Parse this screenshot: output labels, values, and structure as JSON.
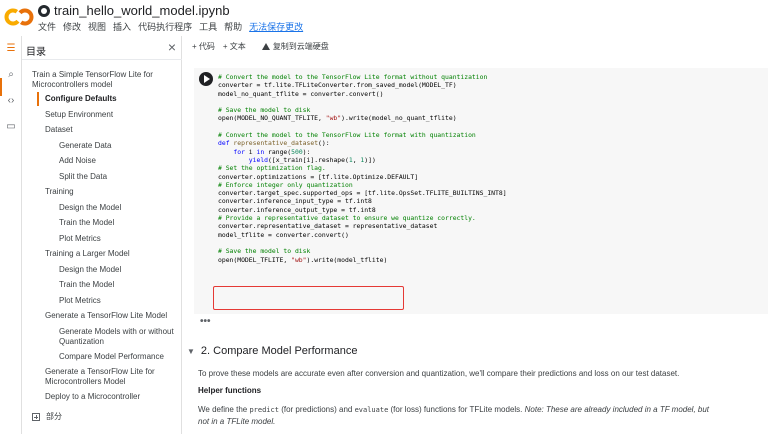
{
  "header": {
    "filename": "train_hello_world_model.ipynb",
    "menu": [
      "文件",
      "修改",
      "视图",
      "插入",
      "代码执行程序",
      "工具",
      "帮助"
    ],
    "unsaved": "无法保存更改"
  },
  "toolbar": {
    "add_code": "+ 代码",
    "add_text": "+ 文本",
    "copy_drive": "复制到云端硬盘"
  },
  "toc": {
    "title": "目录",
    "items": [
      {
        "label": "Train a Simple TensorFlow Lite for Microcontrollers model",
        "level": 1
      },
      {
        "label": "Configure Defaults",
        "level": 2,
        "active": true
      },
      {
        "label": "Setup Environment",
        "level": 2
      },
      {
        "label": "Dataset",
        "level": 2
      },
      {
        "label": "Generate Data",
        "level": 3
      },
      {
        "label": "Add Noise",
        "level": 3
      },
      {
        "label": "Split the Data",
        "level": 3
      },
      {
        "label": "Training",
        "level": 2
      },
      {
        "label": "Design the Model",
        "level": 3
      },
      {
        "label": "Train the Model",
        "level": 3
      },
      {
        "label": "Plot Metrics",
        "level": 3
      },
      {
        "label": "Training a Larger Model",
        "level": 2
      },
      {
        "label": "Design the Model",
        "level": 3
      },
      {
        "label": "Train the Model",
        "level": 3
      },
      {
        "label": "Plot Metrics",
        "level": 3
      },
      {
        "label": "Generate a TensorFlow Lite Model",
        "level": 2
      },
      {
        "label": "Generate Models with or without Quantization",
        "level": 3
      },
      {
        "label": "Compare Model Performance",
        "level": 3
      },
      {
        "label": "Generate a TensorFlow Lite for Microcontrollers Model",
        "level": 2
      },
      {
        "label": "Deploy to a Microcontroller",
        "level": 2
      }
    ],
    "sections_label": "部分"
  },
  "code_lines": [
    [
      [
        "c-com",
        "# Convert the model to the TensorFlow Lite format without quantization"
      ]
    ],
    [
      [
        "c-plain",
        "converter = tf.lite.TFLiteConverter.from_saved_model(MODEL_TF)"
      ]
    ],
    [
      [
        "c-plain",
        "model_no_quant_tflite = converter.convert()"
      ]
    ],
    [
      [
        "c-plain",
        ""
      ]
    ],
    [
      [
        "c-com",
        "# Save the model to disk"
      ]
    ],
    [
      [
        "c-plain",
        "open(MODEL_NO_QUANT_TFLITE, "
      ],
      [
        "c-str",
        "\"wb\""
      ],
      [
        "c-plain",
        ").write(model_no_quant_tflite)"
      ]
    ],
    [
      [
        "c-plain",
        ""
      ]
    ],
    [
      [
        "c-com",
        "# Convert the model to the TensorFlow Lite format with quantization"
      ]
    ],
    [
      [
        "c-kw",
        "def "
      ],
      [
        "c-fn",
        "representative_dataset"
      ],
      [
        "c-plain",
        "():"
      ]
    ],
    [
      [
        "c-plain",
        "    "
      ],
      [
        "c-kw",
        "for"
      ],
      [
        "c-plain",
        " i "
      ],
      [
        "c-kw",
        "in"
      ],
      [
        "c-plain",
        " range("
      ],
      [
        "c-num",
        "500"
      ],
      [
        "c-plain",
        "):"
      ]
    ],
    [
      [
        "c-plain",
        "        "
      ],
      [
        "c-kw",
        "yield"
      ],
      [
        "c-plain",
        "([x_train[i].reshape("
      ],
      [
        "c-num",
        "1"
      ],
      [
        "c-plain",
        ", "
      ],
      [
        "c-num",
        "1"
      ],
      [
        "c-plain",
        ")])"
      ]
    ],
    [
      [
        "c-com",
        "# Set the optimization flag."
      ]
    ],
    [
      [
        "c-plain",
        "converter.optimizations = [tf.lite.Optimize.DEFAULT]"
      ]
    ],
    [
      [
        "c-com",
        "# Enforce integer only quantization"
      ]
    ],
    [
      [
        "c-plain",
        "converter.target_spec.supported_ops = [tf.lite.OpsSet.TFLITE_BUILTINS_INT8]"
      ]
    ],
    [
      [
        "c-plain",
        "converter.inference_input_type = tf.int8"
      ]
    ],
    [
      [
        "c-plain",
        "converter.inference_output_type = tf.int8"
      ]
    ],
    [
      [
        "c-com",
        "# Provide a representative dataset to ensure we quantize correctly."
      ]
    ],
    [
      [
        "c-plain",
        "converter.representative_dataset = representative_dataset"
      ]
    ],
    [
      [
        "c-plain",
        "model_tflite = converter.convert()"
      ]
    ],
    [
      [
        "c-plain",
        ""
      ]
    ],
    [
      [
        "c-com",
        "# Save the model to disk"
      ]
    ],
    [
      [
        "c-plain",
        "open(MODEL_TFLITE, "
      ],
      [
        "c-str",
        "\"wb\""
      ],
      [
        "c-plain",
        ").write(model_tflite)"
      ]
    ]
  ],
  "section": {
    "title": "2. Compare Model Performance",
    "para1": "To prove these models are accurate even after conversion and quantization, we'll compare their predictions and loss on our test dataset.",
    "helper_title": "Helper functions",
    "para2_a": "We define the ",
    "para2_predict": "predict",
    "para2_b": " (for predictions) and ",
    "para2_evaluate": "evaluate",
    "para2_c": " (for loss) functions for TFLite models. ",
    "para2_note": "Note: These are already included in a TF model, but",
    "para2_note2": "not in a TFLite model."
  },
  "colors": {
    "accent": "#e8710a",
    "highlight": "#e53935",
    "comment": "#008000"
  }
}
